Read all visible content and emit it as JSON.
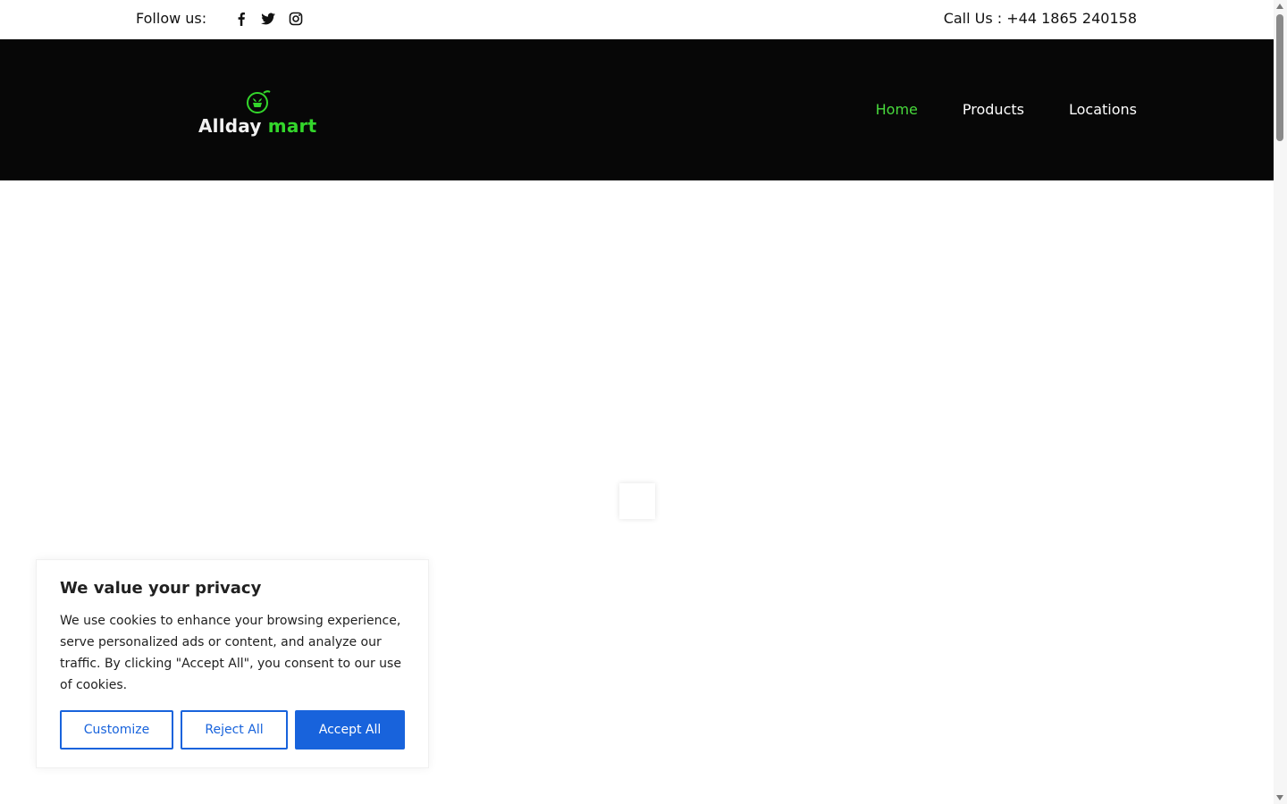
{
  "topbar": {
    "follow_label": "Follow us:",
    "social": [
      {
        "icon": "facebook-icon"
      },
      {
        "icon": "twitter-icon"
      },
      {
        "icon": "instagram-icon"
      }
    ],
    "call": "Call Us : +44 1865 240158"
  },
  "header": {
    "logo": {
      "word1": "Allday",
      "word2": "mart",
      "icon": "leaf-basket-logo-icon"
    },
    "nav": [
      {
        "label": "Home",
        "active": true
      },
      {
        "label": "Products",
        "active": false
      },
      {
        "label": "Locations",
        "active": false
      }
    ]
  },
  "cookie": {
    "title": "We value your privacy",
    "text": "We use cookies to enhance your browsing experience, serve personalized ads or content, and analyze our traffic. By clicking \"Accept All\", you consent to our use of cookies.",
    "customize_label": "Customize",
    "reject_label": "Reject All",
    "accept_label": "Accept All"
  },
  "colors": {
    "header_bg": "#070707",
    "nav_active": "#48d93c",
    "brand_green": "#33d62b",
    "button_blue": "#1863dc"
  }
}
